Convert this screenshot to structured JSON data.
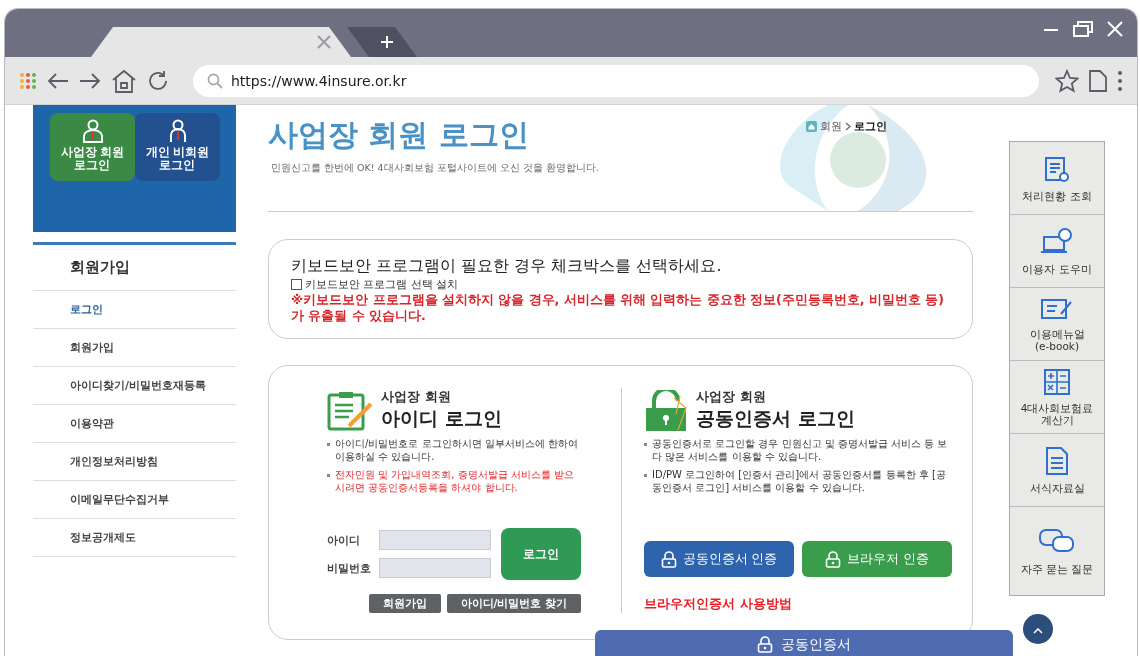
{
  "browser": {
    "url": "https://www.4insure.or.kr"
  },
  "sidebar": {
    "login_tiles": [
      {
        "label": "사업장 회원\n로그인",
        "selected": true
      },
      {
        "label": "개인 비회원\n로그인",
        "selected": false
      }
    ],
    "nav_heading": "회원가입",
    "nav_items": [
      {
        "label": "로그인",
        "selected": true
      },
      {
        "label": "회원가입",
        "selected": false
      },
      {
        "label": "아이디찾기/비밀번호재등록",
        "selected": false
      },
      {
        "label": "이용약관",
        "selected": false
      },
      {
        "label": "개인정보처리방침",
        "selected": false
      },
      {
        "label": "이메일무단수집거부",
        "selected": false
      },
      {
        "label": "정보공개제도",
        "selected": false
      }
    ]
  },
  "page": {
    "title": "사업장 회원 로그인",
    "subtitle": "민원신고를 한번에 OK! 4대사회보험 포털사이트에 오신 것을 환영합니다.",
    "breadcrumb": [
      "회원",
      "로그인"
    ]
  },
  "keyboard_notice": {
    "heading": "키보드보안 프로그램이 필요한 경우 체크박스를 선택하세요.",
    "checkbox": {
      "label": "키보드보안 프로그램 선택 설치",
      "checked": false
    },
    "warning": "※키보드보안 프로그램을 설치하지 않을 경우, 서비스를 위해 입력하는 중요한 정보(주민등록번호, 비밀번호 등)가 유출될 수 있습니다."
  },
  "id_login": {
    "overline": "사업장 회원",
    "title": "아이디 로그인",
    "notes": [
      {
        "text": "아이디/비밀번호로 로그인하시면 일부서비스에 한하여 이용하실 수 있습니다.",
        "kind": "normal"
      },
      {
        "text": "전자민원 및 가입내역조회, 증명서발급 서비스를 받으시려면 공동인증서등록을 하셔야 합니다.",
        "kind": "warning"
      }
    ],
    "fields": [
      {
        "label": "아이디"
      },
      {
        "label": "비밀번호"
      }
    ],
    "login_button": "로그인",
    "links": [
      "회원가입",
      "아이디/비밀번호 찾기"
    ]
  },
  "cert_login": {
    "overline": "사업장 회원",
    "title": "공동인증서 로그인",
    "notes": [
      {
        "text": "공동인증서로 로그인할 경우 민원신고 및 증명서발급 서비스 등 보다 많은 서비스를 이용할 수 있습니다.",
        "kind": "normal"
      },
      {
        "text": "ID/PW 로그인하여 [인증서 관리]에서 공동인증서를 등록한 후 [공동인증서 로그인] 서비스를 이용할 수 있습니다.",
        "kind": "normal"
      }
    ],
    "buttons": [
      {
        "label": "공동인증서 인증",
        "kind": "certificate"
      },
      {
        "label": "브라우저 인증",
        "kind": "browser"
      }
    ],
    "guide_link": "브라우저인증서 사용방법"
  },
  "quick_menu": [
    "처리현황 조회",
    "이용자 도우미",
    "이용메뉴얼\n(e-book)",
    "4대사회보험료\n계산기",
    "서식자료실",
    "자주 묻는 질문"
  ],
  "floating_bar": {
    "label": "공동인증서"
  }
}
